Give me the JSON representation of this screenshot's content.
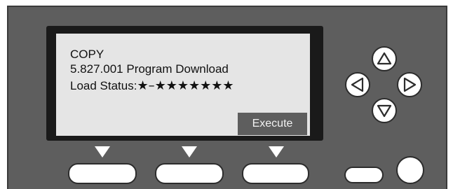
{
  "display": {
    "line1": "COPY",
    "line2": "5.827.001 Program Download",
    "line3_label": "Load Status:",
    "line3_value": "★–★★★★★★★",
    "softkey_label": "Execute"
  },
  "icons": {
    "softkey_arrows": "triangle-down-icon",
    "nav_up": "arrow-up-icon",
    "nav_down": "arrow-down-icon",
    "nav_left": "arrow-left-icon",
    "nav_right": "arrow-right-icon"
  },
  "colors": {
    "panel": "#5e5e5e",
    "lcd_background": "#e5e5e5",
    "key": "#ffffff"
  }
}
